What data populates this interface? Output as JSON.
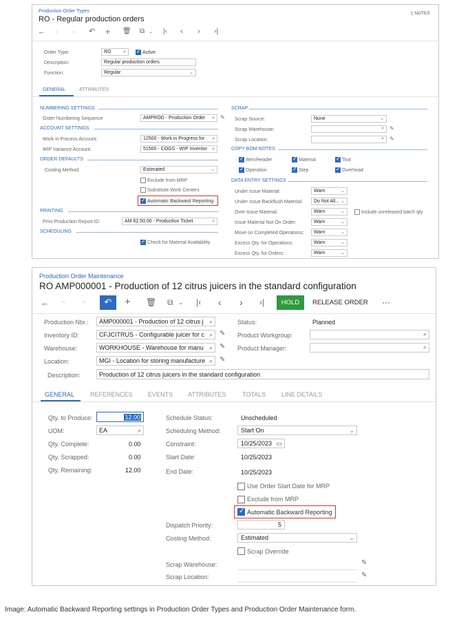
{
  "top": {
    "breadcrumb": "Production Order Types",
    "title": "RO - Regular production orders",
    "notes_label": "NOTES",
    "form": {
      "order_type_label": "Order Type:",
      "order_type_value": "RO",
      "active_label": "Active",
      "description_label": "Description:",
      "description_value": "Regular production orders",
      "function_label": "Function:",
      "function_value": "Regular"
    },
    "tabs": [
      "GENERAL",
      "ATTRIBUTES"
    ],
    "left": {
      "numbering_settings": "NUMBERING SETTINGS",
      "order_numbering_label": "Order Numbering Sequence",
      "order_numbering_value": "AMPROD - Production Order",
      "account_settings": "ACCOUNT SETTINGS",
      "wip_account_label": "Work in Process Account:",
      "wip_account_value": "12500 - Work in Progress for",
      "wip_variance_label": "WIP Variance Account:",
      "wip_variance_value": "51500 - COGS - WIP Inventor",
      "order_defaults": "ORDER DEFAULTS",
      "costing_method_label": "Costing Method:",
      "costing_method_value": "Estimated",
      "exclude_mrp": "Exclude from MRP",
      "substitute_wc": "Substitute Work Centers",
      "auto_backward": "Automatic Backward Reporting",
      "printing": "PRINTING",
      "print_report_label": "Print Production Report ID:",
      "print_report_value": "AM 62.50.00 - Production Ticket",
      "scheduling": "SCHEDULING",
      "check_material": "Check for Material Availability"
    },
    "right": {
      "scrap": "SCRAP",
      "scrap_source_label": "Scrap Source:",
      "scrap_source_value": "None",
      "scrap_warehouse_label": "Scrap Warehouse:",
      "scrap_location_label": "Scrap Location:",
      "copy_bom_notes": "COPY BOM NOTES",
      "item_header": "Item/Header",
      "material": "Material",
      "tool": "Tool",
      "operation": "Operation",
      "step": "Step",
      "overhead": "Overhead",
      "data_entry_settings": "DATA ENTRY SETTINGS",
      "rows": [
        {
          "label": "Under Issue Material:",
          "value": "Warn"
        },
        {
          "label": "Under Issue Backflush Material:",
          "value": "Do Not All..."
        },
        {
          "label": "Over Issue Material:",
          "value": "Warn"
        },
        {
          "label": "Issue Material Not On Order:",
          "value": "Warn"
        },
        {
          "label": "Move on Completed Operations:",
          "value": "Warn"
        },
        {
          "label": "Excess Qty. for Operations:",
          "value": "Warn"
        },
        {
          "label": "Excess Qty. for Orders:",
          "value": "Warn"
        }
      ],
      "include_unreleased": "Include unreleased batch qty"
    }
  },
  "bottom": {
    "breadcrumb": "Production Order Maintenance",
    "title": "RO AMP000001 - Production of 12 citrus juicers in the standard configuration",
    "hold_label": "HOLD",
    "release_label": "RELEASE ORDER",
    "more_label": "···",
    "form": {
      "production_nbr_label": "Production Nbr.:",
      "production_nbr_value": "AMP000001 - Production of 12 citrus j",
      "inventory_id_label": "Inventory ID:",
      "inventory_id_value": "CFJCITRUS - Configurable juicer for c",
      "warehouse_label": "Warehouse:",
      "warehouse_value": "WORKHOUSE - Warehouse for manu",
      "location_label": "Location:",
      "location_value": "MGI - Location for storing manufacture",
      "description_label": "Description:",
      "description_value": "Production of 12 citrus juicers in the standard configuration",
      "status_label": "Status:",
      "status_value": "Planned",
      "product_workgroup_label": "Product Workgroup:",
      "product_manager_label": "Product Manager:"
    },
    "tabs": [
      "GENERAL",
      "REFERENCES",
      "EVENTS",
      "ATTRIBUTES",
      "TOTALS",
      "LINE DETAILS"
    ],
    "general": {
      "qty_produce_label": "Qty. to Produce:",
      "qty_produce_value": "12.00",
      "uom_label": "UOM:",
      "uom_value": "EA",
      "qty_complete_label": "Qty. Complete:",
      "qty_complete_value": "0.00",
      "qty_scrapped_label": "Qty. Scrapped:",
      "qty_scrapped_value": "0.00",
      "qty_remaining_label": "Qty. Remaining:",
      "qty_remaining_value": "12.00",
      "schedule_status_label": "Schedule Status:",
      "schedule_status_value": "Unscheduled",
      "scheduling_method_label": "Scheduling Method:",
      "scheduling_method_value": "Start On",
      "constraint_label": "Constraint:",
      "constraint_value": "10/25/2023",
      "start_date_label": "Start Date:",
      "start_date_value": "10/25/2023",
      "end_date_label": "End Date:",
      "end_date_value": "10/25/2023",
      "use_order_start": "Use Order Start Date for MRP",
      "exclude_mrp": "Exclude from MRP",
      "auto_backward": "Automatic Backward Reporting",
      "dispatch_priority_label": "Dispatch Priority:",
      "dispatch_priority_value": "5",
      "costing_method_label": "Costing Method:",
      "costing_method_value": "Estimated",
      "scrap_override": "Scrap Override",
      "scrap_warehouse_label": "Scrap Warehouse:",
      "scrap_location_label": "Scrap Location:"
    }
  },
  "caption": "Image: Automatic Backward Reporting settings in Production Order Types and Production Order Maintenance form.",
  "colors": {
    "accent": "#2d6ac0",
    "hold": "#2e9a3f",
    "highlight": "#d9342b"
  }
}
